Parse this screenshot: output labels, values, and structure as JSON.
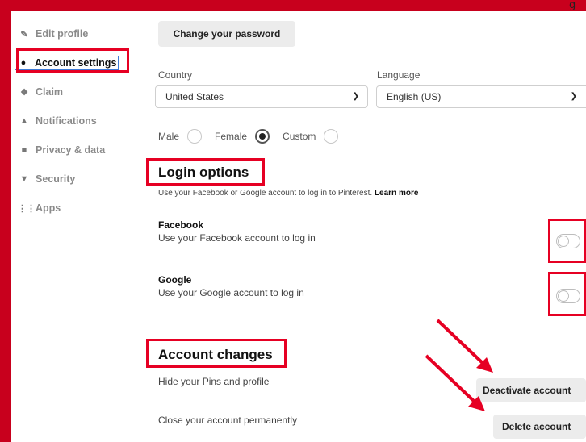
{
  "top_partial_text": "g",
  "sidebar": {
    "items": [
      {
        "label": "Edit profile",
        "icon": "pencil-icon"
      },
      {
        "label": "Account settings",
        "icon": "person-icon",
        "active": true
      },
      {
        "label": "Claim",
        "icon": "claim-icon"
      },
      {
        "label": "Notifications",
        "icon": "bell-icon"
      },
      {
        "label": "Privacy & data",
        "icon": "lock-icon"
      },
      {
        "label": "Security",
        "icon": "shield-icon"
      },
      {
        "label": "Apps",
        "icon": "grid-icon"
      }
    ]
  },
  "password": {
    "button_label": "Change your password"
  },
  "country": {
    "label": "Country",
    "value": "United States"
  },
  "language": {
    "label": "Language",
    "value": "English (US)"
  },
  "gender": {
    "options": [
      "Male",
      "Female",
      "Custom"
    ],
    "selected": "Female"
  },
  "login_options": {
    "heading": "Login options",
    "subtitle": "Use your Facebook or Google account to log in to Pinterest.",
    "learn_more": "Learn more",
    "facebook": {
      "title": "Facebook",
      "desc": "Use your Facebook account to log in",
      "enabled": false
    },
    "google": {
      "title": "Google",
      "desc": "Use your Google account to log in",
      "enabled": false
    }
  },
  "account_changes": {
    "heading": "Account changes",
    "hide_text": "Hide your Pins and profile",
    "deactivate_label": "Deactivate account",
    "close_text": "Close your account permanently",
    "delete_label": "Delete account"
  },
  "colors": {
    "highlight": "#e60023",
    "frame": "#c8001d",
    "focus": "#3d7ad6"
  }
}
